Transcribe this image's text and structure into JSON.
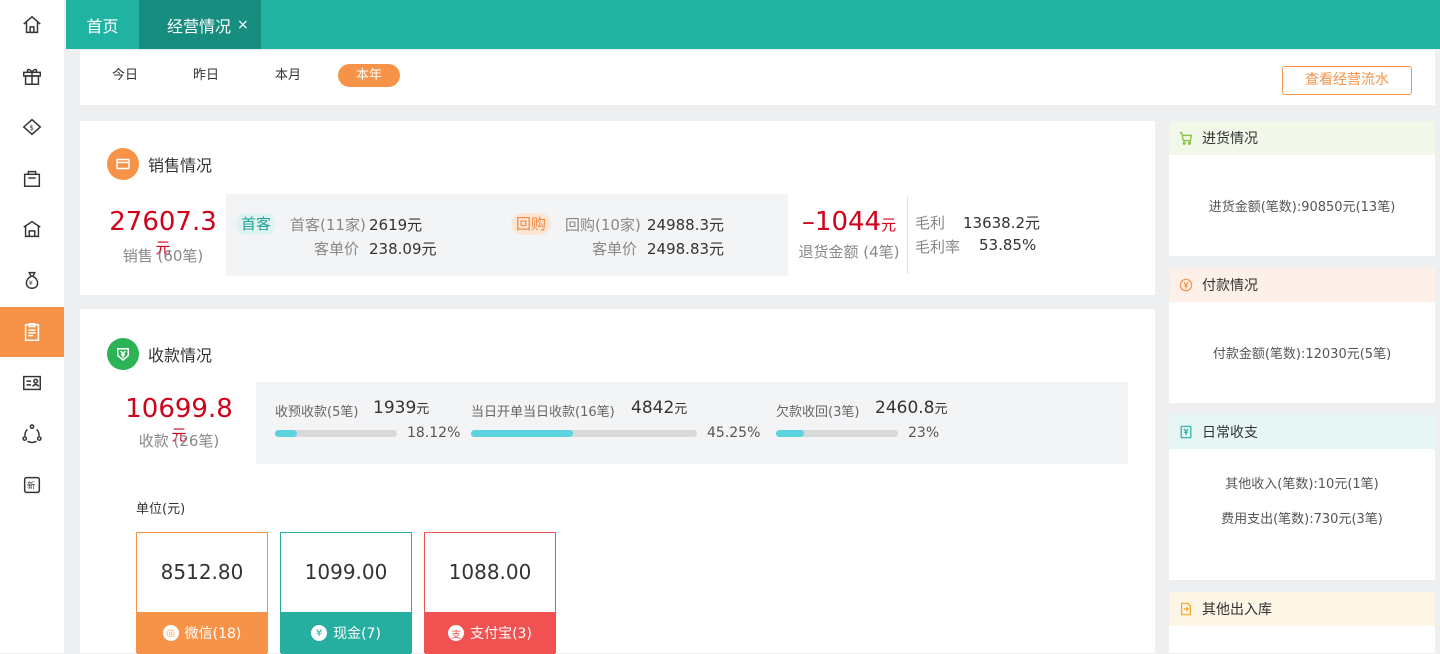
{
  "sidebar": {
    "icons": [
      "home-icon",
      "gift-icon",
      "money-house-icon",
      "shopping-bag-icon",
      "warehouse-icon",
      "money-bag-icon",
      "report-icon",
      "member-card-icon",
      "network-icon",
      "new-badge-icon"
    ],
    "active_index": 6
  },
  "tabs": {
    "home": "首页",
    "active": "经营情况",
    "close": "×"
  },
  "periods": [
    "今日",
    "昨日",
    "本月",
    "本年"
  ],
  "active_period": "本年",
  "flow_button": "查看经营流水",
  "sales": {
    "title": "销售情况",
    "total": "27607.3",
    "unit": "元",
    "count_label": "销售 (60笔)",
    "first": {
      "tag": "首客",
      "label": "首客(11家)",
      "amount": "2619元",
      "avg_label": "客单价",
      "avg": "238.09元"
    },
    "repeat": {
      "tag": "回购",
      "label": "回购(10家)",
      "amount": "24988.3元",
      "avg_label": "客单价",
      "avg": "2498.83元"
    },
    "refund_amount": "–1044",
    "refund_unit": "元",
    "refund_label": "退货金额 (4笔)",
    "gross_profit_label": "毛利",
    "gross_profit": "13638.2元",
    "gross_rate_label": "毛利率",
    "gross_rate": "53.85%"
  },
  "collection": {
    "title": "收款情况",
    "total": "10699.8",
    "unit": "元",
    "count_label": "收款 (26笔)",
    "items": [
      {
        "label": "收预收款(5笔)",
        "amount": "1939",
        "unit": "元",
        "percent_text": "18.12%",
        "fraction": 0.1812
      },
      {
        "label": "当日开单当日收款(16笔)",
        "amount": "4842",
        "unit": "元",
        "percent_text": "45.25%",
        "fraction": 0.4525
      },
      {
        "label": "欠款收回(3笔)",
        "amount": "2460.8",
        "unit": "元",
        "percent_text": "23%",
        "fraction": 0.23
      }
    ],
    "unit_label": "单位(元)",
    "methods": [
      {
        "amount": "8512.80",
        "label": "微信(18)",
        "color": "#f79348",
        "icon": "wechat-icon"
      },
      {
        "amount": "1099.00",
        "label": "现金(7)",
        "color": "#26aea0",
        "icon": "cash-icon"
      },
      {
        "amount": "1088.00",
        "label": "支付宝(3)",
        "color": "#f05252",
        "icon": "alipay-icon"
      }
    ]
  },
  "right": {
    "purchase": {
      "title": "进货情况",
      "line": "进货金额(笔数):90850元(13笔)",
      "color": "#8bc34a"
    },
    "payment": {
      "title": "付款情况",
      "line": "付款金额(笔数):12030元(5笔)",
      "color": "#f79348"
    },
    "daily": {
      "title": "日常收支",
      "line1": "其他收入(笔数):10元(1笔)",
      "line2": "费用支出(笔数):730元(3笔)",
      "color": "#26aea0"
    },
    "stock": {
      "title": "其他出入库",
      "color": "#f5a623"
    }
  },
  "colors": {
    "accent": "#21b3a2",
    "accent_dark": "#178d80",
    "orange": "#f79348",
    "red": "#d0021b"
  }
}
